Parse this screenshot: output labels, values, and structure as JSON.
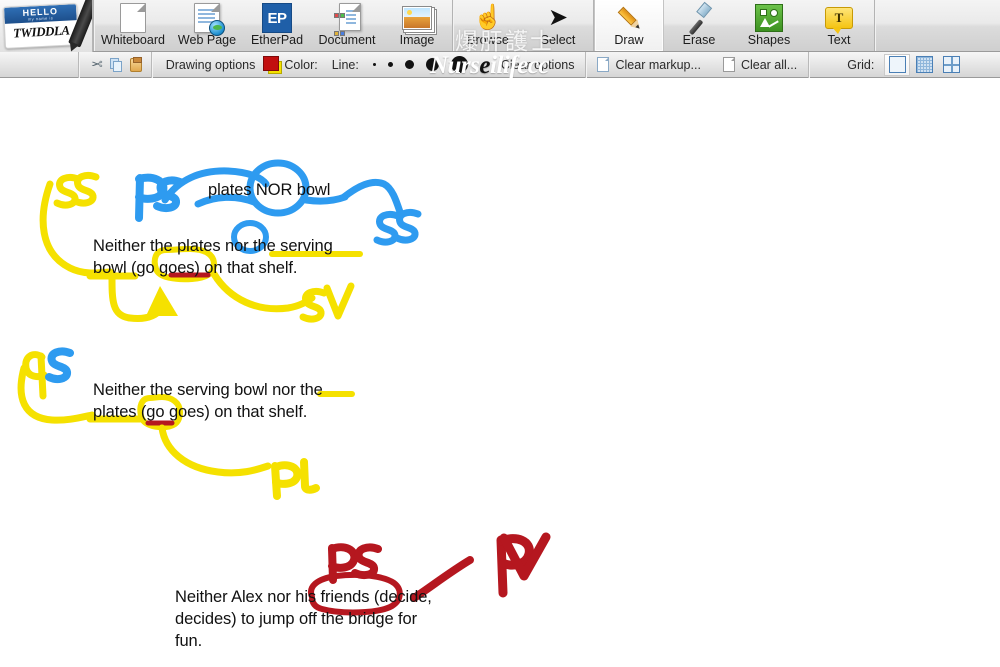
{
  "app": {
    "name": "Twiddla",
    "logo_hello": "HELLO",
    "logo_from": "my name is",
    "logo_name": "TWIDDLA"
  },
  "toolbar": {
    "items": [
      {
        "label": "Whiteboard",
        "icon": "page-icon",
        "active": false
      },
      {
        "label": "Web Page",
        "icon": "web-page-icon",
        "active": false
      },
      {
        "label": "EtherPad",
        "icon": "etherpad-icon",
        "active": false
      },
      {
        "label": "Document",
        "icon": "document-icon",
        "active": false
      },
      {
        "label": "Image",
        "icon": "image-icon",
        "active": false
      },
      {
        "label": "Browse",
        "icon": "hand-icon",
        "active": false
      },
      {
        "label": "Select",
        "icon": "cursor-arrow-icon",
        "active": false
      },
      {
        "label": "Draw",
        "icon": "pencil-icon",
        "active": true
      },
      {
        "label": "Erase",
        "icon": "eraser-icon",
        "active": false
      },
      {
        "label": "Shapes",
        "icon": "shapes-icon",
        "active": false
      },
      {
        "label": "Text",
        "icon": "text-balloon-icon",
        "active": false
      }
    ]
  },
  "options_bar": {
    "cut_icon": "scissors-icon",
    "copy_icon": "copy-icon",
    "paste_icon": "paste-icon",
    "drawing_options_label": "Drawing options",
    "color_label": "Color:",
    "color_current": "#c20f0f",
    "color_secondary": "#f5e100",
    "line_label": "Line:",
    "line_sizes": [
      3,
      5,
      9,
      13,
      17
    ],
    "clear_options_label": "Clear options",
    "clear_markup_label": "Clear markup...",
    "clear_all_label": "Clear all...",
    "grid_label": "Grid:",
    "grid_options": [
      "none",
      "dots",
      "quad"
    ],
    "grid_selected": "none"
  },
  "watermarks": {
    "chinese": "爆肝護士",
    "english_light": "Nurs",
    "english_dark": "e",
    "english_tail": "ilifecc"
  },
  "canvas": {
    "blocks": [
      {
        "id": "block-1",
        "text": "Neither the plates nor the serving\nbowl (go  goes) on that shelf.",
        "annotation_color": "#f5e100",
        "notes": [
          "SS",
          "PS",
          "SS",
          "SV"
        ],
        "typed_note": "plates NOR bowl"
      },
      {
        "id": "block-2",
        "text": "Neither the serving bowl nor the\nplates (go  goes) on that shelf.",
        "annotation_color": "#f5e100",
        "notes": [
          "PS",
          "PL"
        ]
      },
      {
        "id": "block-3",
        "text": "Neither Alex nor his friends (decide,\ndecides) to jump off the bridge for\nfun.",
        "annotation_color": "#b5171f",
        "notes": [
          "PS",
          "PV"
        ]
      }
    ],
    "ink_colors": {
      "yellow": "#f5e100",
      "blue": "#2e9bf0",
      "red": "#b5171f"
    }
  }
}
